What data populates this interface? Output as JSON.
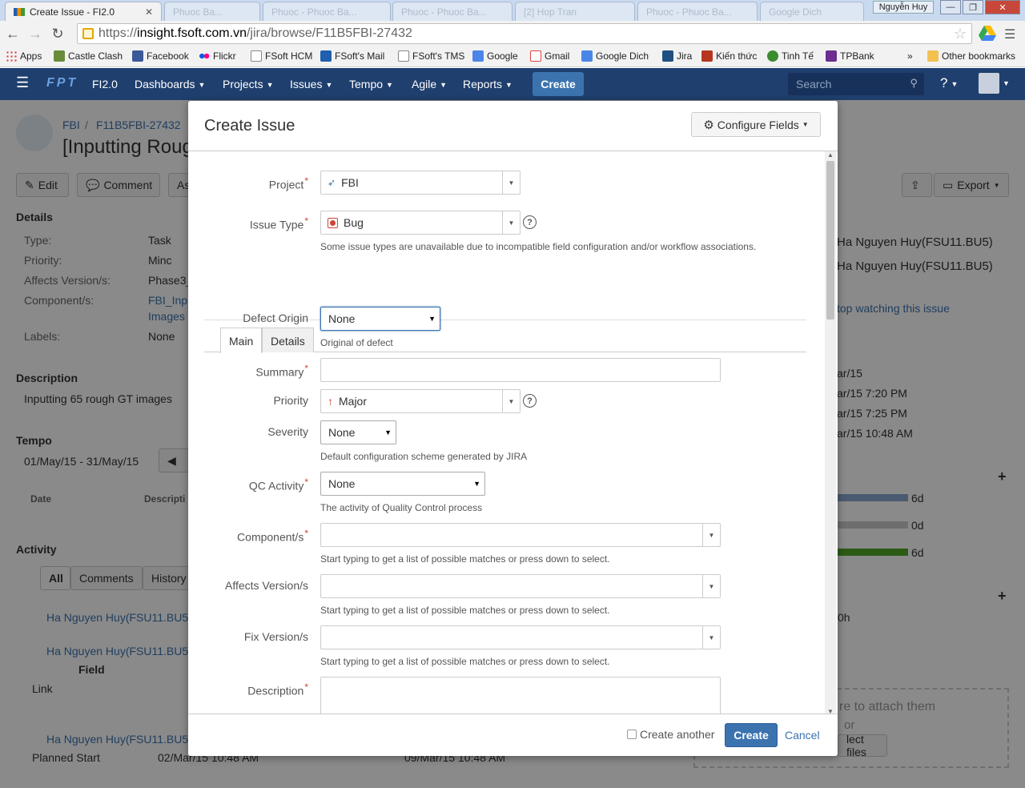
{
  "browser": {
    "tabs": [
      {
        "title": "Create Issue - FI2.0"
      },
      {
        "title": "Phuoc Ba..."
      },
      {
        "title": "Phuoc - Phuoc Ba..."
      },
      {
        "title": "Phuoc - Phuoc Ba..."
      },
      {
        "title": "[2] Hop Tran"
      },
      {
        "title": "Phuoc - Phuoc Ba..."
      },
      {
        "title": "Google Dich"
      }
    ],
    "window_user": "Nguyễn Huy",
    "url_proto": "https://",
    "url_host": "insight.fsoft.com.vn",
    "url_path": "/jira/browse/F11B5FBI-27432",
    "bookmarks": [
      "Apps",
      "Castle Clash",
      "Facebook",
      "Flickr",
      "FSoft HCM",
      "FSoft's Mail",
      "FSoft's TMS",
      "Google",
      "Gmail",
      "Google Dich",
      "Jira",
      "Kiến thức",
      "Tinh Tế",
      "TPBank"
    ],
    "bookmarks_more": "»",
    "other_bookmarks": "Other bookmarks"
  },
  "jira_nav": {
    "logo": "FPT",
    "product": "FI2.0",
    "menus": [
      "Dashboards",
      "Projects",
      "Issues",
      "Tempo",
      "Agile",
      "Reports"
    ],
    "create": "Create",
    "search_placeholder": "Search"
  },
  "issue_page": {
    "breadcrumb_project": "FBI",
    "breadcrumb_sep": "/",
    "breadcrumb_key": "F11B5FBI-27432",
    "title": "[Inputting Roug",
    "buttons": {
      "edit": "Edit",
      "comment": "Comment",
      "assign": "As",
      "export": "Export"
    },
    "details_heading": "Details",
    "details": [
      {
        "label": "Type:",
        "value": "Task"
      },
      {
        "label": "Priority:",
        "value": "Minc"
      },
      {
        "label": "Affects Version/s:",
        "value": "Phase3_"
      },
      {
        "label": "Component/s:",
        "value": "FBI_Inp"
      },
      {
        "label": "",
        "value": "Images"
      },
      {
        "label": "Labels:",
        "value": "None"
      }
    ],
    "description_heading": "Description",
    "description": "Inputting 65 rough GT images",
    "tempo_heading": "Tempo",
    "tempo_range": "01/May/15 - 31/May/15",
    "tempo_cols": [
      "Date",
      "Descripti"
    ],
    "activity_heading": "Activity",
    "activity_tabs": [
      "All",
      "Comments",
      "History"
    ],
    "activity_user": "Ha Nguyen Huy(FSU11.BU5",
    "field_label": "Field",
    "link_label": "Link",
    "planned_start_label": "Planned Start",
    "planned_start_old": "02/Mar/15 10:48 AM",
    "planned_start_new": "09/Mar/15 10:48 AM",
    "people_assignee": "Ha Nguyen Huy(FSU11.BU5)",
    "people_reporter": "Ha Nguyen Huy(FSU11.BU5)",
    "watch_link": "top watching this issue",
    "dates": [
      "ar/15",
      "ar/15 7:20 PM",
      "ar/15 7:25 PM",
      "ar/15 10:48 AM"
    ],
    "time_values": [
      "6d",
      "0d",
      "6d"
    ],
    "time_fill_fraction": [
      1.0,
      1.0,
      1.0
    ],
    "remaining": "0h",
    "drop_text": "re to attach them",
    "drop_or": "or",
    "select_files": "lect files"
  },
  "dialog": {
    "title": "Create Issue",
    "configure_fields": "Configure Fields",
    "project_label": "Project",
    "project_value": "FBI",
    "issue_type_label": "Issue Type",
    "issue_type_value": "Bug",
    "issue_type_hint": "Some issue types are unavailable due to incompatible field configuration and/or workflow associations.",
    "tabs": [
      "Main",
      "Details"
    ],
    "defect_origin_label": "Defect Origin",
    "defect_origin_value": "None",
    "defect_origin_hint": "Original of defect",
    "summary_label": "Summary",
    "summary_value": "",
    "priority_label": "Priority",
    "priority_value": "Major",
    "severity_label": "Severity",
    "severity_value": "None",
    "severity_hint": "Default configuration scheme generated by JIRA",
    "qc_label": "QC Activity",
    "qc_value": "None",
    "qc_hint": "The activity of Quality Control process",
    "components_label": "Component/s",
    "components_hint": "Start typing to get a list of possible matches or press down to select.",
    "affects_label": "Affects Version/s",
    "affects_hint": "Start typing to get a list of possible matches or press down to select.",
    "fix_label": "Fix Version/s",
    "fix_hint": "Start typing to get a list of possible matches or press down to select.",
    "description_label": "Description",
    "required_marker": "*",
    "create_another": "Create another",
    "create": "Create",
    "cancel": "Cancel"
  },
  "colors": {
    "nav_bg": "#1f3f6e",
    "primary": "#3b73af",
    "required": "#d04437"
  }
}
